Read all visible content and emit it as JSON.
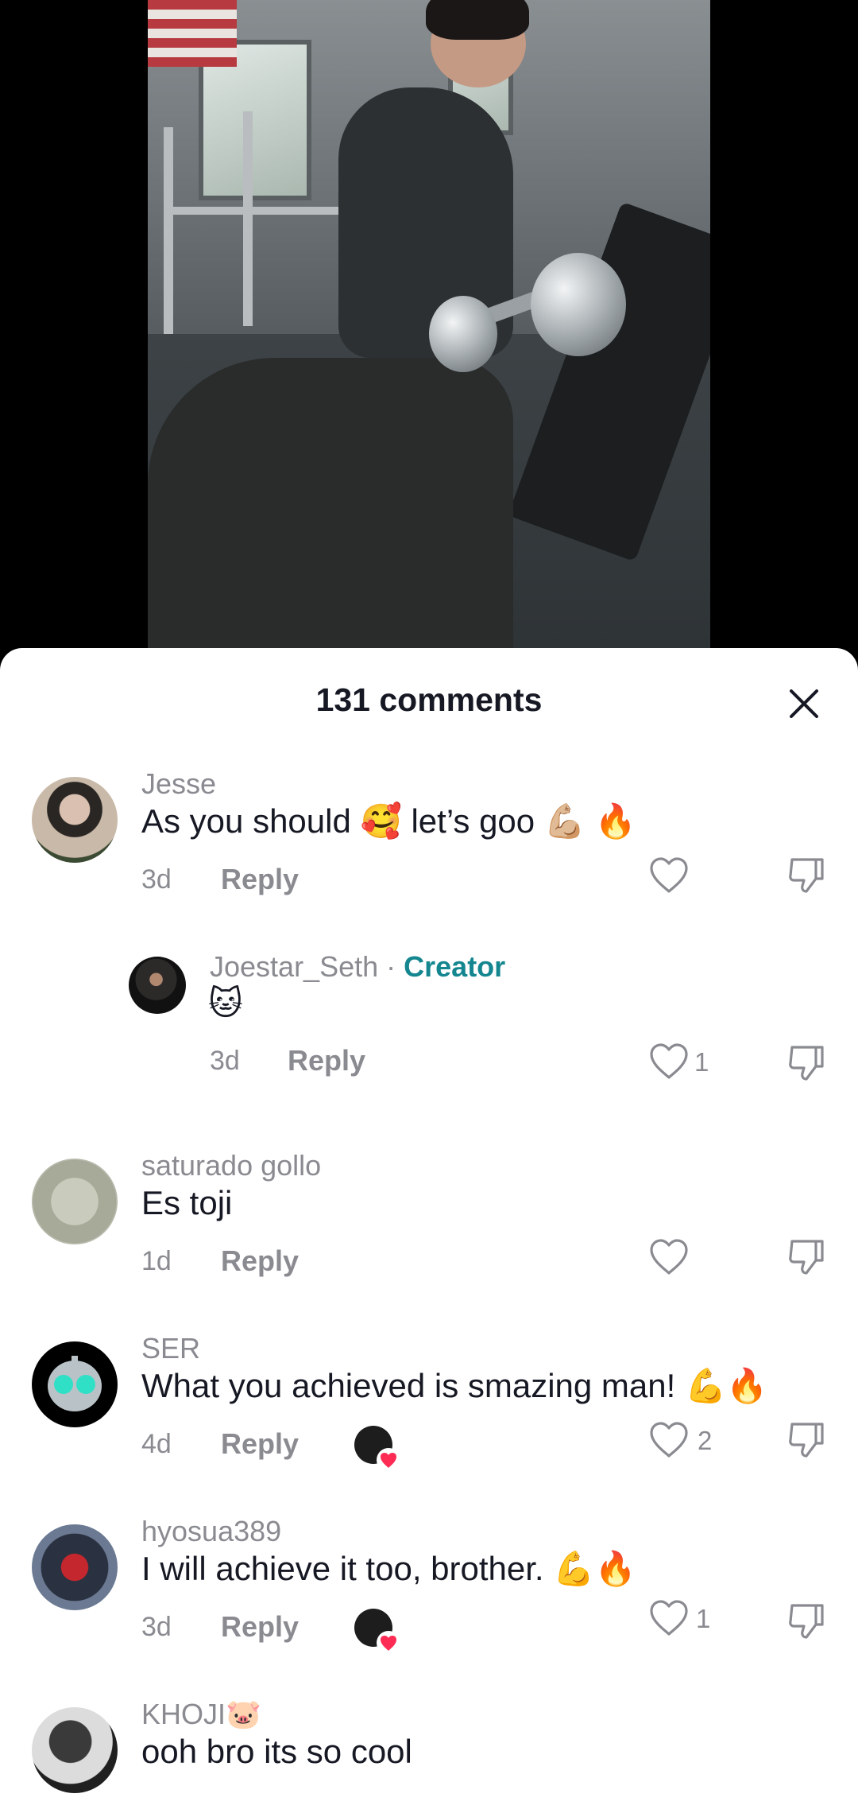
{
  "header": {
    "title": "131 comments"
  },
  "comments": [
    {
      "username": "Jesse",
      "text": "As you should 🥰 let’s goo 💪🏼 🔥",
      "time": "3d",
      "reply": "Reply",
      "likes": ""
    },
    {
      "username": "Joestar_Seth",
      "creator_sep": " · ",
      "creator_label": "Creator",
      "text": "🐱",
      "time": "3d",
      "reply": "Reply",
      "likes": "1"
    },
    {
      "username": "saturado gollo",
      "text": "Es toji",
      "time": "1d",
      "reply": "Reply",
      "likes": ""
    },
    {
      "username": "SER",
      "text": "What you achieved is smazing man! 💪🔥",
      "time": "4d",
      "reply": "Reply",
      "likes": "2"
    },
    {
      "username": "hyosua389",
      "text": "I will achieve it too, brother. 💪🔥",
      "time": "3d",
      "reply": "Reply",
      "likes": "1"
    },
    {
      "username": "KHOJI🐷",
      "text": "ooh bro its so cool",
      "time": "",
      "reply": "",
      "likes": ""
    }
  ],
  "colors": {
    "creator": "#14868f",
    "heart_badge": "#fe2c55",
    "secondary_text": "#8a8b91"
  }
}
